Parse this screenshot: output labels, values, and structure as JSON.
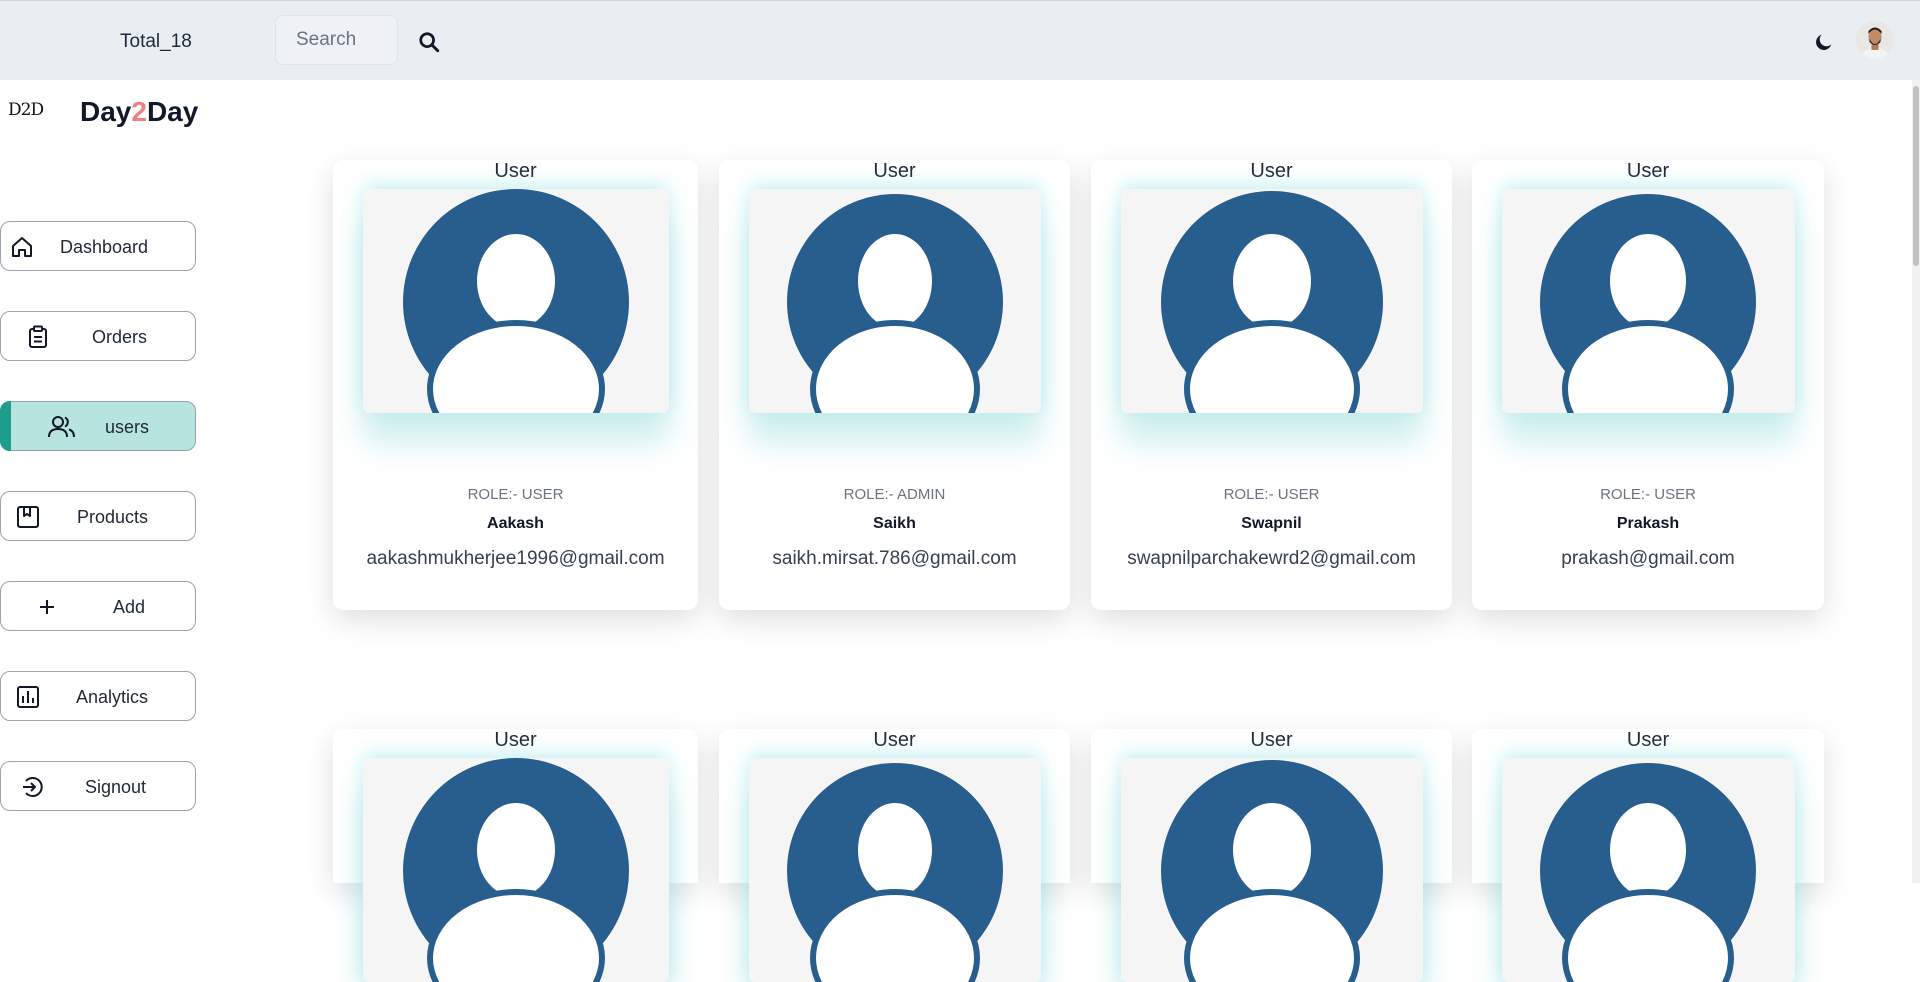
{
  "header": {
    "total_label": "Total_18",
    "search_placeholder": "Search",
    "search_icon": "search-icon",
    "theme_icon": "moon-icon"
  },
  "brand": {
    "logo_text": "D2D",
    "name_part1": "Day",
    "name_accent": "2",
    "name_part2": "Day",
    "accent_color": "#f08080"
  },
  "sidebar": {
    "items": [
      {
        "label": "Dashboard",
        "icon": "home-icon",
        "active": false
      },
      {
        "label": "Orders",
        "icon": "clipboard-icon",
        "active": false
      },
      {
        "label": "users",
        "icon": "users-icon",
        "active": true
      },
      {
        "label": "Products",
        "icon": "bookmark-box-icon",
        "active": false
      },
      {
        "label": "Add",
        "icon": "plus-icon",
        "active": false
      },
      {
        "label": "Analytics",
        "icon": "bar-chart-icon",
        "active": false
      },
      {
        "label": "Signout",
        "icon": "signout-icon",
        "active": false
      }
    ],
    "active_color": "#b7e4df",
    "active_indicator_color": "#1e9c8c"
  },
  "users": [
    {
      "title": "User",
      "role": "ROLE:- USER",
      "name": "Aakash",
      "email": "aakashmukherjee1996@gmail.com"
    },
    {
      "title": "User",
      "role": "ROLE:- ADMIN",
      "name": "Saikh",
      "email": "saikh.mirsat.786@gmail.com"
    },
    {
      "title": "User",
      "role": "ROLE:- USER",
      "name": "Swapnil",
      "email": "swapnilparchakewrd2@gmail.com"
    },
    {
      "title": "User",
      "role": "ROLE:- USER",
      "name": "Prakash",
      "email": "prakash@gmail.com"
    },
    {
      "title": "User"
    },
    {
      "title": "User"
    },
    {
      "title": "User"
    },
    {
      "title": "User"
    }
  ],
  "avatar_color": "#285e8e"
}
